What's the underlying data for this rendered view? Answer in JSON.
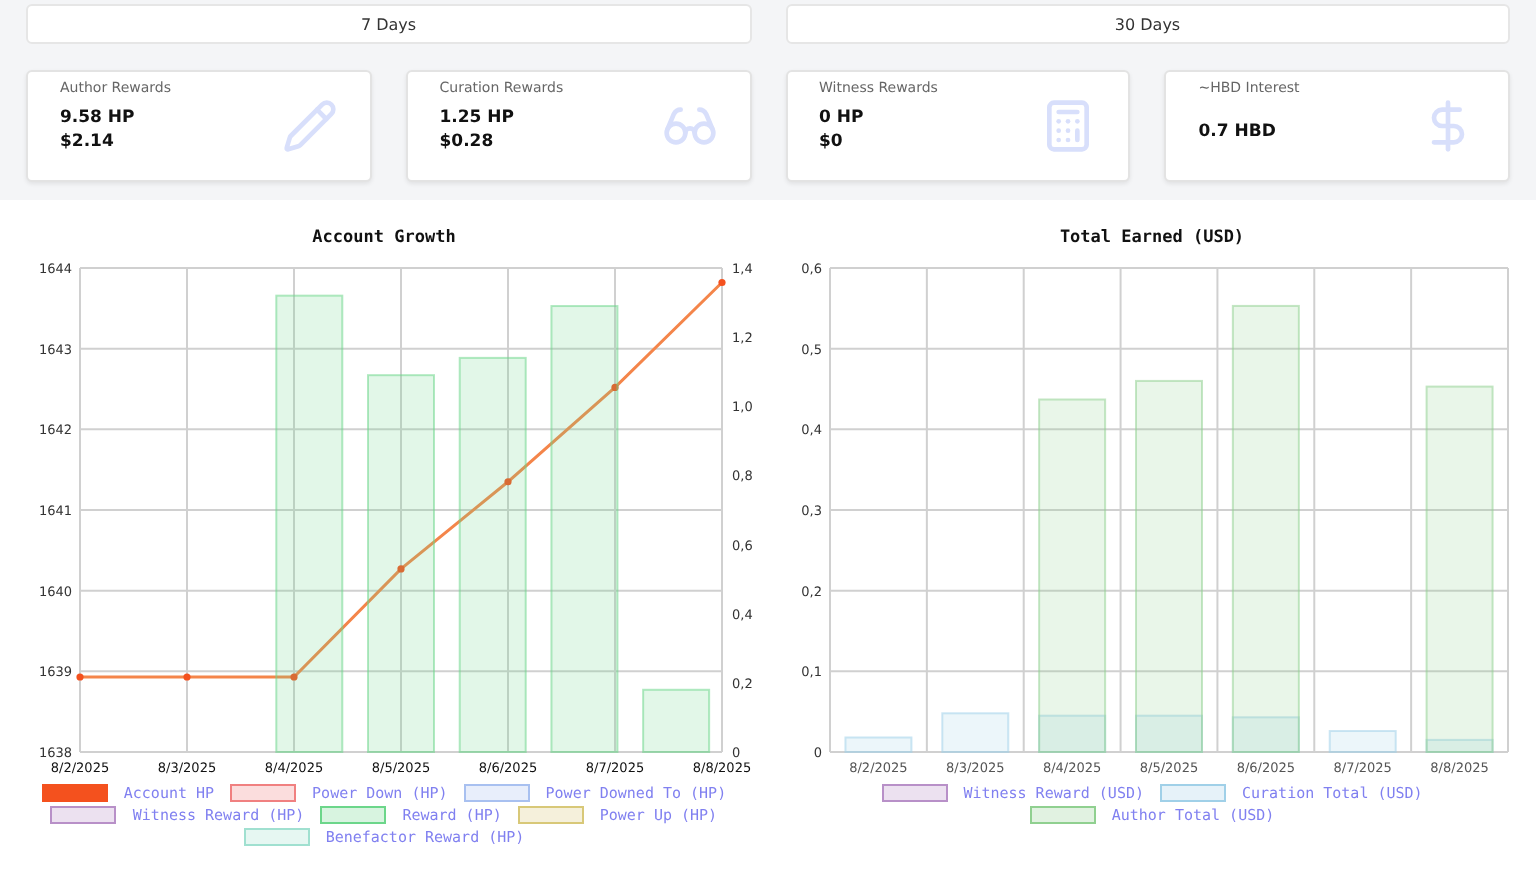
{
  "tabs": [
    {
      "label": "7 Days",
      "selected": false
    },
    {
      "label": "30 Days",
      "selected": false
    }
  ],
  "cards": [
    {
      "title": "Author Rewards",
      "lines": [
        "9.58 HP",
        "$2.14"
      ]
    },
    {
      "title": "Curation Rewards",
      "lines": [
        "1.25 HP",
        "$0.28"
      ]
    },
    {
      "title": "Witness Rewards",
      "lines": [
        "0 HP",
        "$0"
      ]
    },
    {
      "title": "~HBD Interest",
      "lines": [
        "0.7 HBD"
      ]
    }
  ],
  "charts": [
    {
      "chart_data": {
        "type": "bar",
        "title": "Account Growth",
        "grid": true,
        "categories": [
          "8/2/2025",
          "8/3/2025",
          "8/4/2025",
          "8/5/2025",
          "8/6/2025",
          "8/7/2025",
          "8/8/2025"
        ],
        "ylim": [
          1638,
          1644
        ],
        "yticks": [
          1638,
          1639,
          1640,
          1641,
          1642,
          1643,
          1644
        ],
        "y2lim": [
          0,
          1.4
        ],
        "y2ticks": [
          {
            "value": 0,
            "label": "0"
          },
          {
            "value": 0.2,
            "label": "0,2"
          },
          {
            "value": 0.4,
            "label": "0,4"
          },
          {
            "value": 0.6,
            "label": "0,6"
          },
          {
            "value": 0.8,
            "label": "0,8"
          },
          {
            "value": 1,
            "label": "1,0"
          },
          {
            "value": 1.2,
            "label": "1,2"
          },
          {
            "value": 1.4,
            "label": "1,4"
          }
        ],
        "series": [
          {
            "name": "Account HP",
            "color": "#f4511e",
            "type": "line",
            "marker": true,
            "values": [
              1638.93,
              1638.93,
              1638.93,
              1640.27,
              1641.35,
              1642.52,
              1643.82
            ]
          },
          {
            "name": "Power Down (HP)",
            "color": "#f08080",
            "axis": "y2",
            "values": [
              null,
              null,
              null,
              null,
              null,
              null,
              null
            ]
          },
          {
            "name": "Power Downed To (HP)",
            "color": "#a8c0f0",
            "axis": "y2",
            "values": [
              null,
              null,
              null,
              null,
              null,
              null,
              null
            ]
          },
          {
            "name": "Witness Reward (HP)",
            "color": "#b890c8",
            "axis": "y2",
            "values": [
              null,
              null,
              null,
              null,
              null,
              null,
              null
            ]
          },
          {
            "name": "Reward (HP)",
            "color": "#6cd68a",
            "axis": "y2",
            "values": [
              null,
              null,
              1.32,
              1.09,
              1.14,
              1.29,
              0.18
            ]
          },
          {
            "name": "Power Up (HP)",
            "color": "#d8c878",
            "axis": "y2",
            "values": [
              null,
              null,
              null,
              null,
              null,
              null,
              null
            ]
          },
          {
            "name": "Benefactor Reward (HP)",
            "color": "#a0e0d0",
            "axis": "y2",
            "values": [
              null,
              null,
              null,
              null,
              null,
              null,
              null
            ]
          }
        ]
      }
    },
    {
      "chart_data": {
        "type": "bar",
        "title": "Total Earned (USD)",
        "grid": true,
        "categories": [
          "8/2/2025",
          "8/3/2025",
          "8/4/2025",
          "8/5/2025",
          "8/6/2025",
          "8/7/2025",
          "8/8/2025"
        ],
        "ylim": [
          0,
          0.6
        ],
        "yticks": [
          {
            "value": 0,
            "label": "0"
          },
          {
            "value": 0.1,
            "label": "0,1"
          },
          {
            "value": 0.2,
            "label": "0,2"
          },
          {
            "value": 0.3,
            "label": "0,3"
          },
          {
            "value": 0.4,
            "label": "0,4"
          },
          {
            "value": 0.5,
            "label": "0,5"
          },
          {
            "value": 0.6,
            "label": "0,6"
          }
        ],
        "stacked": false,
        "series": [
          {
            "name": "Witness Reward (USD)",
            "color": "#b890c8",
            "values": [
              null,
              null,
              null,
              null,
              null,
              null,
              null
            ]
          },
          {
            "name": "Curation Total (USD)",
            "color": "#a0d0e8",
            "values": [
              0.018,
              0.048,
              0.045,
              0.045,
              0.043,
              0.026,
              0.015
            ]
          },
          {
            "name": "Author Total (USD)",
            "color": "#90d090",
            "values": [
              null,
              null,
              0.437,
              0.46,
              0.553,
              null,
              0.453
            ]
          }
        ]
      }
    }
  ]
}
